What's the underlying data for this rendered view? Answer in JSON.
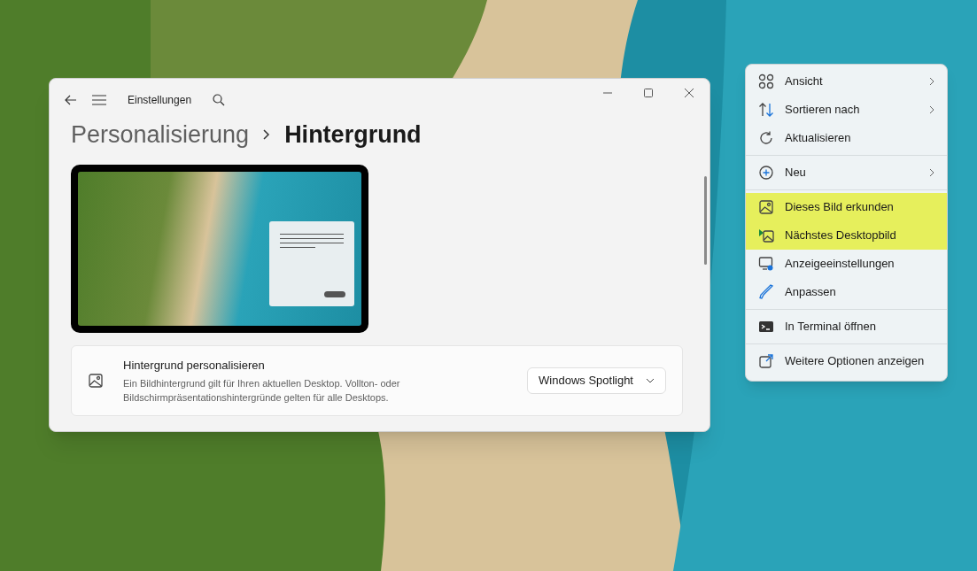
{
  "settings_window": {
    "title": "Einstellungen",
    "breadcrumb": [
      "Personalisierung",
      "Hintergrund"
    ],
    "setting": {
      "title": "Hintergrund personalisieren",
      "description": "Ein Bildhintergrund gilt für Ihren aktuellen Desktop. Vollton- oder Bildschirmpräsentationshintergründe gelten für alle Desktops.",
      "dropdown": "Windows Spotlight"
    }
  },
  "context_menu": {
    "groups": [
      [
        {
          "label": "Ansicht",
          "submenu": true,
          "highlighted": false
        },
        {
          "label": "Sortieren nach",
          "submenu": true,
          "highlighted": false
        },
        {
          "label": "Aktualisieren",
          "submenu": false,
          "highlighted": false
        }
      ],
      [
        {
          "label": "Neu",
          "submenu": true,
          "highlighted": false
        }
      ],
      [
        {
          "label": "Dieses Bild erkunden",
          "submenu": false,
          "highlighted": true
        },
        {
          "label": "Nächstes Desktopbild",
          "submenu": false,
          "highlighted": true
        },
        {
          "label": "Anzeigeeinstellungen",
          "submenu": false,
          "highlighted": false
        },
        {
          "label": "Anpassen",
          "submenu": false,
          "highlighted": false
        }
      ],
      [
        {
          "label": "In Terminal öffnen",
          "submenu": false,
          "highlighted": false
        }
      ],
      [
        {
          "label": "Weitere Optionen anzeigen",
          "submenu": false,
          "highlighted": false
        }
      ]
    ]
  }
}
